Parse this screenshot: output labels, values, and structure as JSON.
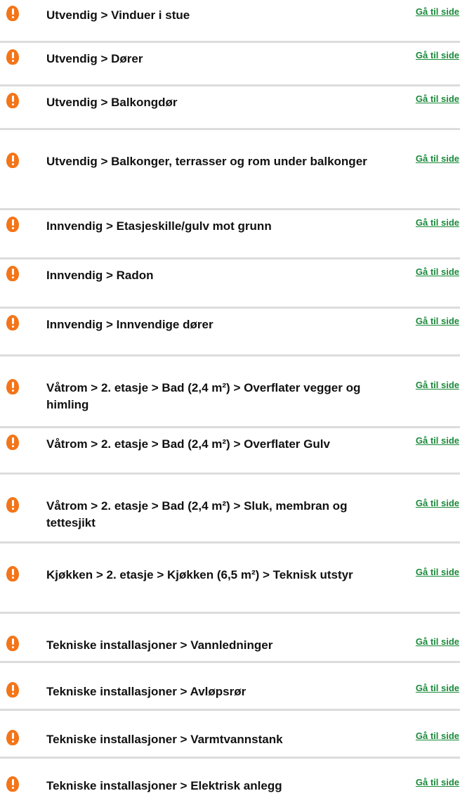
{
  "colors": {
    "warning_icon": "#f37519",
    "link": "#1a8a3a",
    "divider": "#dcdcdc"
  },
  "link_label": "Gå til side",
  "items": [
    {
      "label": "Utvendig > Vinduer i stue",
      "icon": "exclamation-icon"
    },
    {
      "label": "Utvendig > Dører",
      "icon": "exclamation-icon"
    },
    {
      "label": "Utvendig > Balkongdør",
      "icon": "exclamation-icon"
    },
    {
      "label": "Utvendig > Balkonger, terrasser og rom under balkonger",
      "icon": "exclamation-icon"
    },
    {
      "label": "Innvendig > Etasjeskille/gulv mot grunn",
      "icon": "exclamation-icon"
    },
    {
      "label": "Innvendig > Radon",
      "icon": "exclamation-icon"
    },
    {
      "label": "Innvendig > Innvendige dører",
      "icon": "exclamation-icon"
    },
    {
      "label": "Våtrom > 2. etasje > Bad (2,4 m²) > Overflater vegger og himling",
      "icon": "exclamation-icon"
    },
    {
      "label": "Våtrom > 2. etasje > Bad (2,4 m²) > Overflater Gulv",
      "icon": "exclamation-icon"
    },
    {
      "label": "Våtrom > 2. etasje > Bad (2,4 m²) > Sluk, membran og tettesjikt",
      "icon": "exclamation-icon"
    },
    {
      "label": "Kjøkken > 2. etasje > Kjøkken (6,5 m²) > Teknisk utstyr",
      "icon": "exclamation-icon"
    },
    {
      "label": "Tekniske installasjoner > Vannledninger",
      "icon": "exclamation-icon"
    },
    {
      "label": "Tekniske installasjoner > Avløpsrør",
      "icon": "exclamation-icon"
    },
    {
      "label": "Tekniske installasjoner > Varmtvannstank",
      "icon": "exclamation-icon"
    },
    {
      "label": "Tekniske installasjoner > Elektrisk anlegg",
      "icon": "exclamation-icon"
    }
  ]
}
